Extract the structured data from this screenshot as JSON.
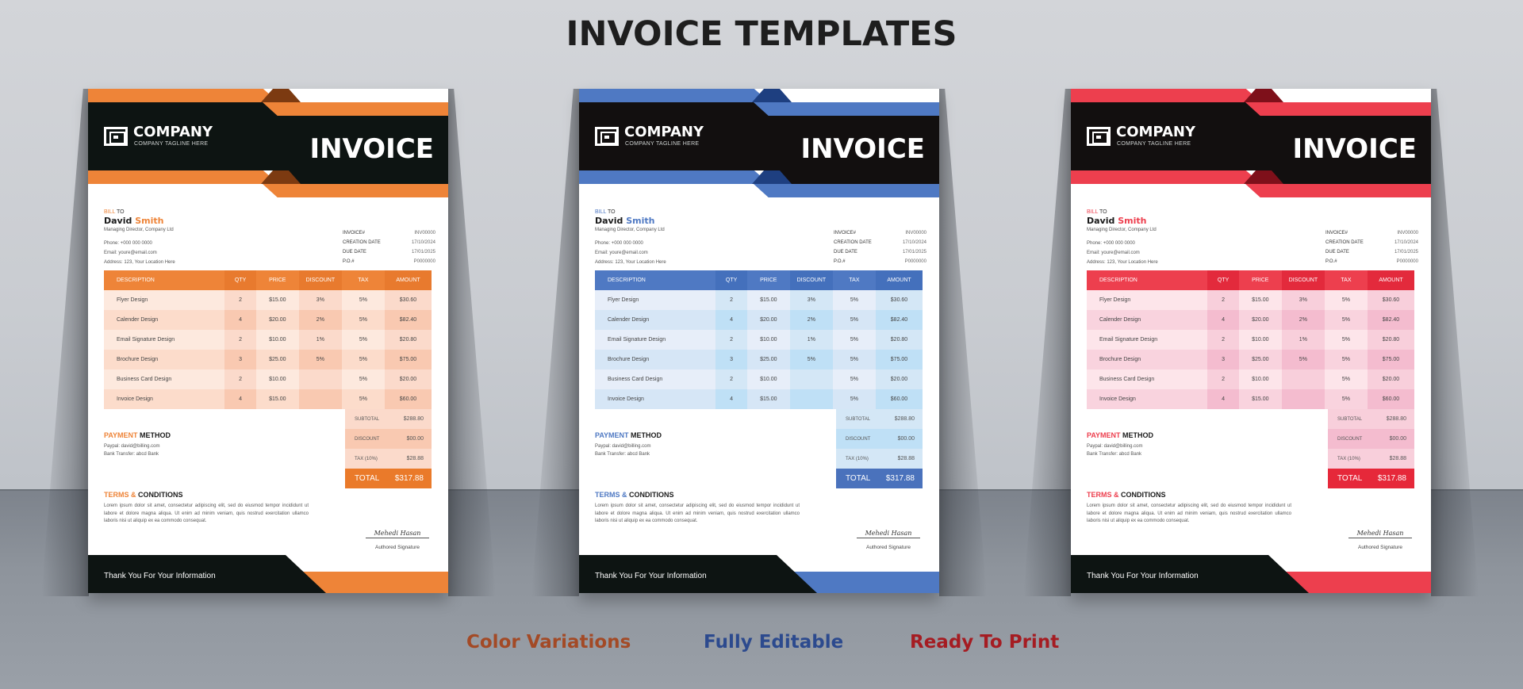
{
  "page": {
    "title": "INVOICE TEMPLATES",
    "taglines": [
      {
        "text": "Color Variations",
        "color": "#a34a26"
      },
      {
        "text": "Fully Editable",
        "color": "#2c4a8e"
      },
      {
        "text": "Ready To Print",
        "color": "#a51c22"
      }
    ]
  },
  "invoices": [
    {
      "variant": "orange",
      "accent_color": "#ee8438",
      "company": {
        "name": "COMPANY",
        "tagline": "COMPANY TAGLINE HERE"
      },
      "heading": "INVOICE",
      "bill_to": {
        "label_accent": "BILL",
        "label_rest": "TO",
        "first_name": "David",
        "last_name": "Smith",
        "role": "Managing Director, Company Ltd",
        "phone": "Phone: +000 000 0000",
        "email": "Email: youre@email.com",
        "address": "Address: 123, Your Location Here"
      },
      "meta": [
        {
          "label": "INVOICE#",
          "value": "INV00000"
        },
        {
          "label": "CREATION DATE",
          "value": "17/10/2024"
        },
        {
          "label": "DUE DATE",
          "value": "17/01/2025"
        },
        {
          "label": "P.O.#",
          "value": "P0000000"
        }
      ]
    },
    {
      "variant": "blue",
      "accent_color": "#4f79c3",
      "company": {
        "name": "COMPANY",
        "tagline": "COMPANY TAGLINE HERE"
      },
      "heading": "INVOICE",
      "bill_to": {
        "label_accent": "BILL",
        "label_rest": "TO",
        "first_name": "David",
        "last_name": "Smith",
        "role": "Managing Director, Company Ltd",
        "phone": "Phone: +000 000 0000",
        "email": "Email: youre@email.com",
        "address": "Address: 123, Your Location Here"
      },
      "meta": [
        {
          "label": "INVOICE#",
          "value": "INV00000"
        },
        {
          "label": "CREATION DATE",
          "value": "17/10/2024"
        },
        {
          "label": "DUE DATE",
          "value": "17/01/2025"
        },
        {
          "label": "P.O.#",
          "value": "P0000000"
        }
      ]
    },
    {
      "variant": "red",
      "accent_color": "#ed3f4e",
      "company": {
        "name": "COMPANY",
        "tagline": "COMPANY TAGLINE HERE"
      },
      "heading": "INVOICE",
      "bill_to": {
        "label_accent": "BILL",
        "label_rest": "TO",
        "first_name": "David",
        "last_name": "Smith",
        "role": "Managing Director, Company Ltd",
        "phone": "Phone: +000 000 0000",
        "email": "Email: youre@email.com",
        "address": "Address: 123, Your Location Here"
      },
      "meta": [
        {
          "label": "INVOICE#",
          "value": "INV00000"
        },
        {
          "label": "CREATION DATE",
          "value": "17/10/2024"
        },
        {
          "label": "DUE DATE",
          "value": "17/01/2025"
        },
        {
          "label": "P.O.#",
          "value": "P0000000"
        }
      ]
    }
  ],
  "table": {
    "columns": [
      "DESCRIPTION",
      "QTY",
      "PRICE",
      "DISCOUNT",
      "TAX",
      "AMOUNT"
    ],
    "rows": [
      [
        "Flyer Design",
        "2",
        "$15.00",
        "3%",
        "5%",
        "$30.60"
      ],
      [
        "Calender Design",
        "4",
        "$20.00",
        "2%",
        "5%",
        "$82.40"
      ],
      [
        "Email Signature Design",
        "2",
        "$10.00",
        "1%",
        "5%",
        "$20.80"
      ],
      [
        "Brochure Design",
        "3",
        "$25.00",
        "5%",
        "5%",
        "$75.00"
      ],
      [
        "Business Card Design",
        "2",
        "$10.00",
        "",
        "5%",
        "$20.00"
      ],
      [
        "Invoice Design",
        "4",
        "$15.00",
        "",
        "5%",
        "$60.00"
      ]
    ]
  },
  "totals": {
    "rows": [
      {
        "label": "SUBTOTAL",
        "value": "$288.80"
      },
      {
        "label": "DISCOUNT",
        "value": "$00.00"
      },
      {
        "label": "TAX (10%)",
        "value": "$28.88"
      }
    ],
    "total_label": "TOTAL",
    "total_value": "$317.88"
  },
  "payment": {
    "title_accent": "PAYMENT",
    "title_rest": "METHOD",
    "lines": [
      "Paypal: david@billing.com",
      "Bank Transfer: abcd Bank"
    ]
  },
  "terms": {
    "title_accent": "TERMS &",
    "title_rest": "CONDITIONS",
    "text": "Lorem ipsum dolor sit amet, consectetur adipiscing elit, sed do eiusmod tempor incididunt ut labore et dolore magna aliqua. Ut enim ad minim veniam, quis nostrud exercitation ullamco laboris nisi ut aliquip ex ea commodo consequat."
  },
  "signature": {
    "scribble": "Mehedi Hasan",
    "label": "Authored Signature"
  },
  "footer": {
    "text": "Thank You For Your Information"
  }
}
